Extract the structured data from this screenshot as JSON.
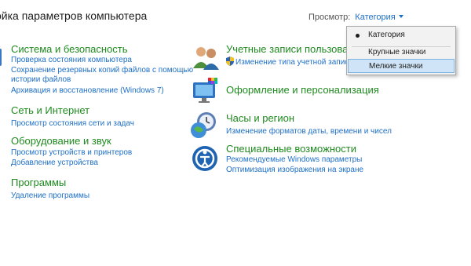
{
  "header": {
    "title": "ойка параметров компьютера",
    "view_by_label": "Просмотр:",
    "view_by_value": "Категория"
  },
  "dropdown": {
    "options": [
      "Категория",
      "Крупные значки",
      "Мелкие значки"
    ],
    "checked_index": 0,
    "highlighted_index": 2
  },
  "categories": {
    "system": {
      "title": "Система и безопасность",
      "links": [
        "Проверка состояния компьютера",
        "Сохранение резервных копий файлов с помощью",
        "истории файлов",
        "Архивация и восстановление (Windows 7)"
      ]
    },
    "network": {
      "title": "Сеть и Интернет",
      "links": [
        "Просмотр состояния сети и задач"
      ]
    },
    "hardware": {
      "title": "Оборудование и звук",
      "links": [
        "Просмотр устройств и принтеров",
        "Добавление устройства"
      ]
    },
    "programs": {
      "title": "Программы",
      "links": [
        "Удаление программы"
      ]
    },
    "accounts": {
      "title": "Учетные записи пользовате",
      "links": [
        "Изменение типа учетной записи"
      ]
    },
    "appearance": {
      "title": "Оформление и персонализация",
      "links": []
    },
    "clock": {
      "title": "Часы и регион",
      "links": [
        "Изменение форматов даты, времени и чисел"
      ]
    },
    "access": {
      "title": "Специальные возможности",
      "links": [
        "Рекомендуемые Windows параметры",
        "Оптимизация изображения на экране"
      ]
    }
  }
}
